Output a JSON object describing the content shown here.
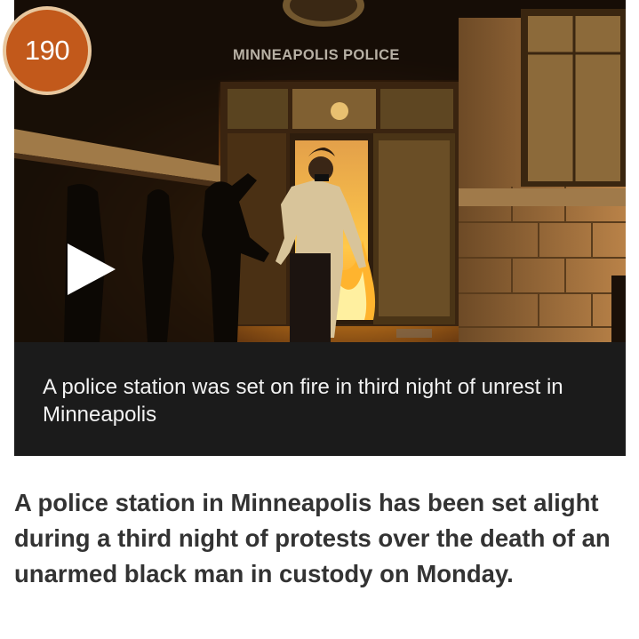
{
  "badge": {
    "count": "190",
    "color": "#c2591b"
  },
  "video": {
    "photo_sign_text": "MINNEAPOLIS POLICE",
    "caption": "A police station was set on fire in third night of unrest in Minneapolis",
    "play_icon": "play-icon"
  },
  "article": {
    "headline": "A police station in Minneapolis has been set alight during a third night of protests over the death of an unarmed black man in custody on Monday."
  },
  "colors": {
    "caption_bg": "#1b1b1b",
    "headline_text": "#333333",
    "fire": "#ffb42e"
  }
}
